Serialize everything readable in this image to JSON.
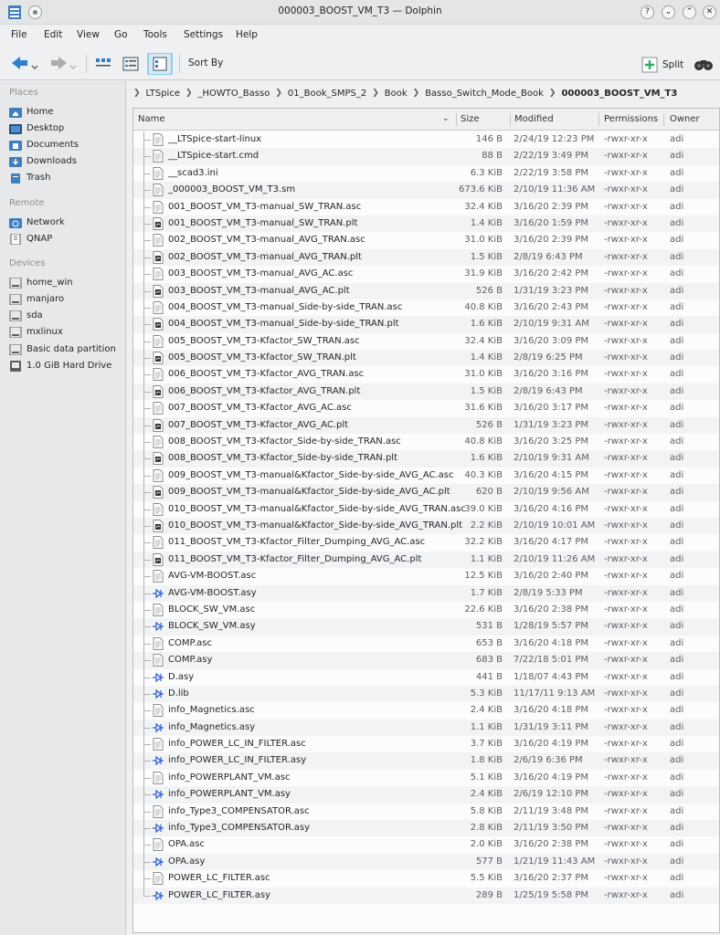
{
  "window": {
    "title": "000003_BOOST_VM_T3 — Dolphin"
  },
  "menu": [
    "File",
    "Edit",
    "View",
    "Go",
    "Tools",
    "Settings",
    "Help"
  ],
  "toolbar": {
    "sort_by": "Sort By",
    "split": "Split"
  },
  "sidebar": {
    "places_label": "Places",
    "places": [
      {
        "label": "Home",
        "icon": "home-folder-icon"
      },
      {
        "label": "Desktop",
        "icon": "desktop-icon"
      },
      {
        "label": "Documents",
        "icon": "documents-folder-icon"
      },
      {
        "label": "Downloads",
        "icon": "downloads-folder-icon"
      },
      {
        "label": "Trash",
        "icon": "trash-icon"
      }
    ],
    "remote_label": "Remote",
    "remote": [
      {
        "label": "Network",
        "icon": "network-folder-icon"
      },
      {
        "label": "QNAP",
        "icon": "nas-icon"
      }
    ],
    "devices_label": "Devices",
    "devices": [
      {
        "label": "home_win",
        "icon": "drive-icon"
      },
      {
        "label": "manjaro",
        "icon": "drive-icon"
      },
      {
        "label": "sda",
        "icon": "drive-icon"
      },
      {
        "label": "mxlinux",
        "icon": "drive-icon"
      },
      {
        "label": "Basic data partition",
        "icon": "drive-icon"
      },
      {
        "label": "1.0 GiB Hard Drive",
        "icon": "usb-drive-icon"
      }
    ]
  },
  "breadcrumb": [
    "LTSpice",
    "_HOWTO_Basso",
    "01_Book_SMPS_2",
    "Book",
    "Basso_Switch_Mode_Book",
    "000003_BOOST_VM_T3"
  ],
  "columns": {
    "name": "Name",
    "size": "Size",
    "modified": "Modified",
    "permissions": "Permissions",
    "owner": "Owner"
  },
  "files": [
    {
      "name": "__LTSpice-start-linux",
      "size": "146 B",
      "modified": "2/24/19 12:23 PM",
      "perm": "-rwxr-xr-x",
      "owner": "adi",
      "type": "text"
    },
    {
      "name": "__LTSpice-start.cmd",
      "size": "88 B",
      "modified": "2/22/19 3:49 PM",
      "perm": "-rwxr-xr-x",
      "owner": "adi",
      "type": "text"
    },
    {
      "name": "__scad3.ini",
      "size": "6.3 KiB",
      "modified": "2/22/19 3:58 PM",
      "perm": "-rwxr-xr-x",
      "owner": "adi",
      "type": "text"
    },
    {
      "name": "_000003_BOOST_VM_T3.sm",
      "size": "673.6 KiB",
      "modified": "2/10/19 11:36 AM",
      "perm": "-rwxr-xr-x",
      "owner": "adi",
      "type": "text"
    },
    {
      "name": "001_BOOST_VM_T3-manual_SW_TRAN.asc",
      "size": "32.4 KiB",
      "modified": "3/16/20 2:39 PM",
      "perm": "-rwxr-xr-x",
      "owner": "adi",
      "type": "text"
    },
    {
      "name": "001_BOOST_VM_T3-manual_SW_TRAN.plt",
      "size": "1.4 KiB",
      "modified": "3/16/20 1:59 PM",
      "perm": "-rwxr-xr-x",
      "owner": "adi",
      "type": "plt"
    },
    {
      "name": "002_BOOST_VM_T3-manual_AVG_TRAN.asc",
      "size": "31.0 KiB",
      "modified": "3/16/20 2:39 PM",
      "perm": "-rwxr-xr-x",
      "owner": "adi",
      "type": "text"
    },
    {
      "name": "002_BOOST_VM_T3-manual_AVG_TRAN.plt",
      "size": "1.5 KiB",
      "modified": "2/8/19 6:43 PM",
      "perm": "-rwxr-xr-x",
      "owner": "adi",
      "type": "plt"
    },
    {
      "name": "003_BOOST_VM_T3-manual_AVG_AC.asc",
      "size": "31.9 KiB",
      "modified": "3/16/20 2:42 PM",
      "perm": "-rwxr-xr-x",
      "owner": "adi",
      "type": "text"
    },
    {
      "name": "003_BOOST_VM_T3-manual_AVG_AC.plt",
      "size": "526 B",
      "modified": "1/31/19 3:23 PM",
      "perm": "-rwxr-xr-x",
      "owner": "adi",
      "type": "plt"
    },
    {
      "name": "004_BOOST_VM_T3-manual_Side-by-side_TRAN.asc",
      "size": "40.8 KiB",
      "modified": "3/16/20 2:43 PM",
      "perm": "-rwxr-xr-x",
      "owner": "adi",
      "type": "text"
    },
    {
      "name": "004_BOOST_VM_T3-manual_Side-by-side_TRAN.plt",
      "size": "1.6 KiB",
      "modified": "2/10/19 9:31 AM",
      "perm": "-rwxr-xr-x",
      "owner": "adi",
      "type": "plt"
    },
    {
      "name": "005_BOOST_VM_T3-Kfactor_SW_TRAN.asc",
      "size": "32.4 KiB",
      "modified": "3/16/20 3:09 PM",
      "perm": "-rwxr-xr-x",
      "owner": "adi",
      "type": "text"
    },
    {
      "name": "005_BOOST_VM_T3-Kfactor_SW_TRAN.plt",
      "size": "1.4 KiB",
      "modified": "2/8/19 6:25 PM",
      "perm": "-rwxr-xr-x",
      "owner": "adi",
      "type": "plt"
    },
    {
      "name": "006_BOOST_VM_T3-Kfactor_AVG_TRAN.asc",
      "size": "31.0 KiB",
      "modified": "3/16/20 3:16 PM",
      "perm": "-rwxr-xr-x",
      "owner": "adi",
      "type": "text"
    },
    {
      "name": "006_BOOST_VM_T3-Kfactor_AVG_TRAN.plt",
      "size": "1.5 KiB",
      "modified": "2/8/19 6:43 PM",
      "perm": "-rwxr-xr-x",
      "owner": "adi",
      "type": "plt"
    },
    {
      "name": "007_BOOST_VM_T3-Kfactor_AVG_AC.asc",
      "size": "31.6 KiB",
      "modified": "3/16/20 3:17 PM",
      "perm": "-rwxr-xr-x",
      "owner": "adi",
      "type": "text"
    },
    {
      "name": "007_BOOST_VM_T3-Kfactor_AVG_AC.plt",
      "size": "526 B",
      "modified": "1/31/19 3:23 PM",
      "perm": "-rwxr-xr-x",
      "owner": "adi",
      "type": "plt"
    },
    {
      "name": "008_BOOST_VM_T3-Kfactor_Side-by-side_TRAN.asc",
      "size": "40.8 KiB",
      "modified": "3/16/20 3:25 PM",
      "perm": "-rwxr-xr-x",
      "owner": "adi",
      "type": "text"
    },
    {
      "name": "008_BOOST_VM_T3-Kfactor_Side-by-side_TRAN.plt",
      "size": "1.6 KiB",
      "modified": "2/10/19 9:31 AM",
      "perm": "-rwxr-xr-x",
      "owner": "adi",
      "type": "plt"
    },
    {
      "name": "009_BOOST_VM_T3-manual&Kfactor_Side-by-side_AVG_AC.asc",
      "size": "40.3 KiB",
      "modified": "3/16/20 4:15 PM",
      "perm": "-rwxr-xr-x",
      "owner": "adi",
      "type": "text"
    },
    {
      "name": "009_BOOST_VM_T3-manual&Kfactor_Side-by-side_AVG_AC.plt",
      "size": "620 B",
      "modified": "2/10/19 9:56 AM",
      "perm": "-rwxr-xr-x",
      "owner": "adi",
      "type": "plt"
    },
    {
      "name": "010_BOOST_VM_T3-manual&Kfactor_Side-by-side_AVG_TRAN.asc",
      "size": "39.0 KiB",
      "modified": "3/16/20 4:16 PM",
      "perm": "-rwxr-xr-x",
      "owner": "adi",
      "type": "text"
    },
    {
      "name": "010_BOOST_VM_T3-manual&Kfactor_Side-by-side_AVG_TRAN.plt",
      "size": "2.2 KiB",
      "modified": "2/10/19 10:01 AM",
      "perm": "-rwxr-xr-x",
      "owner": "adi",
      "type": "plt"
    },
    {
      "name": "011_BOOST_VM_T3-Kfactor_Filter_Dumping_AVG_AC.asc",
      "size": "32.2 KiB",
      "modified": "3/16/20 4:17 PM",
      "perm": "-rwxr-xr-x",
      "owner": "adi",
      "type": "text"
    },
    {
      "name": "011_BOOST_VM_T3-Kfactor_Filter_Dumping_AVG_AC.plt",
      "size": "1.1 KiB",
      "modified": "2/10/19 11:26 AM",
      "perm": "-rwxr-xr-x",
      "owner": "adi",
      "type": "plt"
    },
    {
      "name": "AVG-VM-BOOST.asc",
      "size": "12.5 KiB",
      "modified": "3/16/20 2:40 PM",
      "perm": "-rwxr-xr-x",
      "owner": "adi",
      "type": "text"
    },
    {
      "name": "AVG-VM-BOOST.asy",
      "size": "1.7 KiB",
      "modified": "2/8/19 5:33 PM",
      "perm": "-rwxr-xr-x",
      "owner": "adi",
      "type": "asy"
    },
    {
      "name": "BLOCK_SW_VM.asc",
      "size": "22.6 KiB",
      "modified": "3/16/20 2:38 PM",
      "perm": "-rwxr-xr-x",
      "owner": "adi",
      "type": "text"
    },
    {
      "name": "BLOCK_SW_VM.asy",
      "size": "531 B",
      "modified": "1/28/19 5:57 PM",
      "perm": "-rwxr-xr-x",
      "owner": "adi",
      "type": "asy"
    },
    {
      "name": "COMP.asc",
      "size": "653 B",
      "modified": "3/16/20 4:18 PM",
      "perm": "-rwxr-xr-x",
      "owner": "adi",
      "type": "text"
    },
    {
      "name": "COMP.asy",
      "size": "683 B",
      "modified": "7/22/18 5:01 PM",
      "perm": "-rwxr-xr-x",
      "owner": "adi",
      "type": "text"
    },
    {
      "name": "D.asy",
      "size": "441 B",
      "modified": "1/18/07 4:43 PM",
      "perm": "-rwxr-xr-x",
      "owner": "adi",
      "type": "asy"
    },
    {
      "name": "D.lib",
      "size": "5.3 KiB",
      "modified": "11/17/11 9:13 AM",
      "perm": "-rwxr-xr-x",
      "owner": "adi",
      "type": "asy"
    },
    {
      "name": "info_Magnetics.asc",
      "size": "2.4 KiB",
      "modified": "3/16/20 4:18 PM",
      "perm": "-rwxr-xr-x",
      "owner": "adi",
      "type": "text"
    },
    {
      "name": "info_Magnetics.asy",
      "size": "1.1 KiB",
      "modified": "1/31/19 3:11 PM",
      "perm": "-rwxr-xr-x",
      "owner": "adi",
      "type": "asy"
    },
    {
      "name": "info_POWER_LC_IN_FILTER.asc",
      "size": "3.7 KiB",
      "modified": "3/16/20 4:19 PM",
      "perm": "-rwxr-xr-x",
      "owner": "adi",
      "type": "text"
    },
    {
      "name": "info_POWER_LC_IN_FILTER.asy",
      "size": "1.8 KiB",
      "modified": "2/6/19 6:36 PM",
      "perm": "-rwxr-xr-x",
      "owner": "adi",
      "type": "asy"
    },
    {
      "name": "info_POWERPLANT_VM.asc",
      "size": "5.1 KiB",
      "modified": "3/16/20 4:19 PM",
      "perm": "-rwxr-xr-x",
      "owner": "adi",
      "type": "text"
    },
    {
      "name": "info_POWERPLANT_VM.asy",
      "size": "2.4 KiB",
      "modified": "2/6/19 12:10 PM",
      "perm": "-rwxr-xr-x",
      "owner": "adi",
      "type": "asy"
    },
    {
      "name": "info_Type3_COMPENSATOR.asc",
      "size": "5.8 KiB",
      "modified": "2/11/19 3:48 PM",
      "perm": "-rwxr-xr-x",
      "owner": "adi",
      "type": "text"
    },
    {
      "name": "info_Type3_COMPENSATOR.asy",
      "size": "2.8 KiB",
      "modified": "2/11/19 3:50 PM",
      "perm": "-rwxr-xr-x",
      "owner": "adi",
      "type": "asy"
    },
    {
      "name": "OPA.asc",
      "size": "2.0 KiB",
      "modified": "3/16/20 2:38 PM",
      "perm": "-rwxr-xr-x",
      "owner": "adi",
      "type": "text"
    },
    {
      "name": "OPA.asy",
      "size": "577 B",
      "modified": "1/21/19 11:43 AM",
      "perm": "-rwxr-xr-x",
      "owner": "adi",
      "type": "asy"
    },
    {
      "name": "POWER_LC_FILTER.asc",
      "size": "5.5 KiB",
      "modified": "3/16/20 2:37 PM",
      "perm": "-rwxr-xr-x",
      "owner": "adi",
      "type": "text"
    },
    {
      "name": "POWER_LC_FILTER.asy",
      "size": "289 B",
      "modified": "1/25/19 5:58 PM",
      "perm": "-rwxr-xr-x",
      "owner": "adi",
      "type": "asy"
    }
  ],
  "colors": {
    "asy_icon": "#2a5bd7",
    "folder_icon": "#3f7fbf",
    "selection": "#3daee9"
  }
}
